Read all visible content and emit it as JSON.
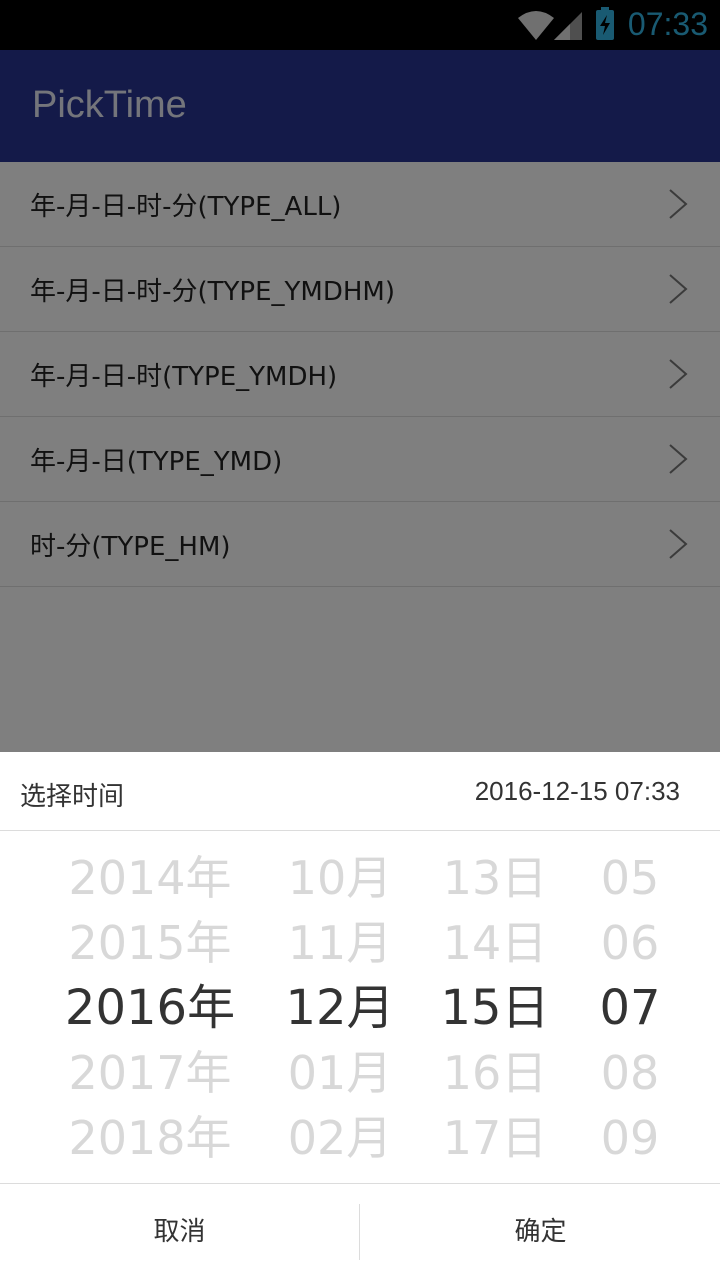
{
  "status_bar": {
    "time": "07:33"
  },
  "app_bar": {
    "title": "PickTime"
  },
  "list": {
    "items": [
      {
        "label": "年-月-日-时-分(TYPE_ALL)"
      },
      {
        "label": "年-月-日-时-分(TYPE_YMDHM)"
      },
      {
        "label": "年-月-日-时(TYPE_YMDH)"
      },
      {
        "label": "年-月-日(TYPE_YMD)"
      },
      {
        "label": "时-分(TYPE_HM)"
      }
    ]
  },
  "picker": {
    "title": "选择时间",
    "current_value": "2016-12-15 07:33",
    "year": [
      "2014年",
      "2015年",
      "2016年",
      "2017年",
      "2018年"
    ],
    "month": [
      "10月",
      "11月",
      "12月",
      "01月",
      "02月"
    ],
    "day": [
      "13日",
      "14日",
      "15日",
      "16日",
      "17日"
    ],
    "minute": [
      "05",
      "06",
      "07",
      "08",
      "09"
    ],
    "cancel_label": "取消",
    "confirm_label": "确定"
  }
}
